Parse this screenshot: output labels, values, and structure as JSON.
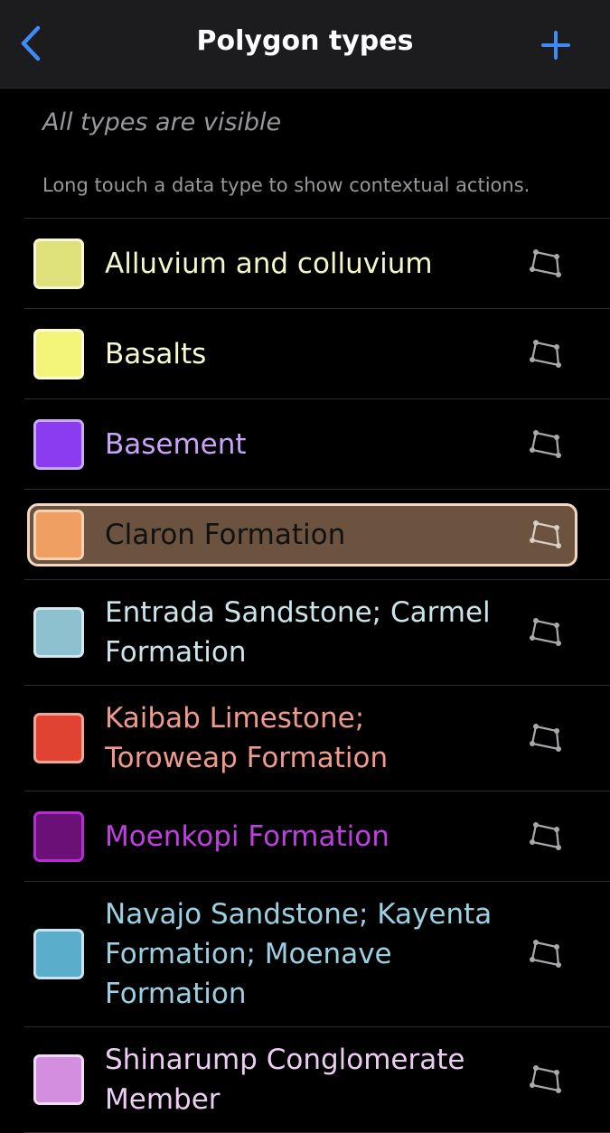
{
  "navbar": {
    "title": "Polygon types",
    "back_icon": "chevron-left-icon",
    "add_icon": "plus-icon",
    "accent_color": "#3e8af7"
  },
  "status": {
    "visibility_text": "All types are visible",
    "hint_text": "Long touch a data type to show contextual actions."
  },
  "types": [
    {
      "label": "Alluvium and colluvium",
      "fill": "#dfe27a",
      "border": "#f7f7d4",
      "text_color": "#f4f6c6",
      "selected": false
    },
    {
      "label": "Basalts",
      "fill": "#f2f57a",
      "border": "#fafad8",
      "text_color": "#f8f9cf",
      "selected": false
    },
    {
      "label": "Basement",
      "fill": "#8b3cf0",
      "border": "#c9a9f5",
      "text_color": "#c9a3f7",
      "selected": false
    },
    {
      "label": "Claron Formation",
      "fill": "#ef9f61",
      "border": "#f6d2b2",
      "text_color": "#111111",
      "selected": true
    },
    {
      "label": "Entrada Sandstone; Carmel Formation",
      "fill": "#8ec1cf",
      "border": "#d2e8ee",
      "text_color": "#cbe4ea",
      "selected": false
    },
    {
      "label": "Kaibab Limestone; Toroweap Formation",
      "fill": "#e04332",
      "border": "#f0a59b",
      "text_color": "#ef9a8c",
      "selected": false
    },
    {
      "label": "Moenkopi Formation",
      "fill": "#6a1077",
      "border": "#b22ed0",
      "text_color": "#c13ee0",
      "selected": false
    },
    {
      "label": "Navajo Sandstone; Kayenta Formation; Moenave Formation",
      "fill": "#5aaecb",
      "border": "#c7e4ee",
      "text_color": "#9ad0e2",
      "selected": false
    },
    {
      "label": "Shinarump Conglomerate Member",
      "fill": "#d38ee0",
      "border": "#f2d9f6",
      "text_color": "#ebcdf2",
      "selected": false
    }
  ],
  "row_icon": "polygon-icon"
}
